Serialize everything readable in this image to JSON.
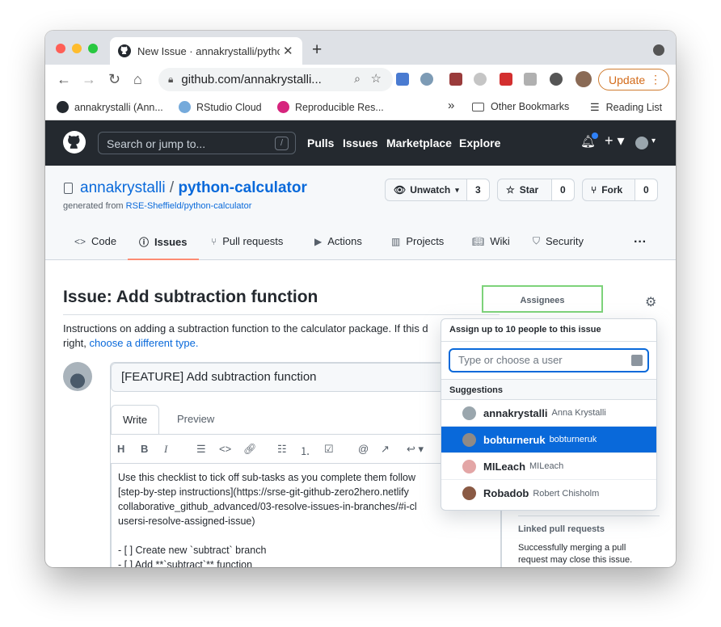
{
  "browser": {
    "tab_title": "New Issue · annakrystalli/pytho",
    "tab_close": "✕",
    "new_tab": "+",
    "url": "github.com/annakrystalli...",
    "update_label": "Update",
    "bookmarks": [
      {
        "label": "annakrystalli (Ann...",
        "color": "#24292f"
      },
      {
        "label": "RStudio Cloud",
        "color": "#75aadb"
      },
      {
        "label": "Reproducible Res...",
        "color": "#d6247d"
      }
    ],
    "bookmarks_more": "»",
    "other_bookmarks": "Other Bookmarks",
    "reading_list": "Reading List"
  },
  "github": {
    "search_placeholder": "Search or jump to...",
    "search_key": "/",
    "nav": [
      "Pulls",
      "Issues",
      "Marketplace",
      "Explore"
    ]
  },
  "repo": {
    "owner": "annakrystalli",
    "separator": "/",
    "name": "python-calculator",
    "generated_prefix": "generated from",
    "generated_link": "RSE-Sheffield/python-calculator",
    "unwatch_label": "Unwatch",
    "unwatch_count": "3",
    "star_label": "Star",
    "star_count": "0",
    "fork_label": "Fork",
    "fork_count": "0",
    "tabs": [
      "Code",
      "Issues",
      "Pull requests",
      "Actions",
      "Projects",
      "Wiki",
      "Security"
    ],
    "more": "···"
  },
  "issue": {
    "heading": "Issue: Add subtraction function",
    "instructions_line1": "Instructions on adding a subtraction function to the calculator package. If this d",
    "instructions_line2": "right,",
    "instructions_link": "choose a different type.",
    "title_value": "[FEATURE] Add subtraction function",
    "write_tab": "Write",
    "preview_tab": "Preview",
    "body_lines": [
      "Use this checklist to tick off sub-tasks as you complete them follow",
      "[step-by-step instructions](https://srse-git-github-zero2hero.netlify",
      "collaborative_github_advanced/03-resolve-issues-in-branches/#i-cl",
      "usersi-resolve-assigned-issue)",
      "",
      "- [ ] Create new `subtract` branch",
      "- [ ] Add **`subtract`** function"
    ]
  },
  "sidebar": {
    "assignees_label": "Assignees",
    "popup_title": "Assign up to 10 people to this issue",
    "filter_placeholder": "Type or choose a user",
    "suggestions_label": "Suggestions",
    "users": [
      {
        "username": "annakrystalli",
        "fullname": "Anna Krystalli",
        "selected": false,
        "color": "#9aa6ad"
      },
      {
        "username": "bobturneruk",
        "fullname": "bobturneruk",
        "selected": true,
        "color": "#8f8a86"
      },
      {
        "username": "MILeach",
        "fullname": "MILeach",
        "selected": false,
        "color": "#e3a6a6"
      },
      {
        "username": "Robadob",
        "fullname": "Robert Chisholm",
        "selected": false,
        "color": "#8a5a44"
      }
    ],
    "linked_title": "Linked pull requests",
    "linked_text_1": "Successfully merging a pull",
    "linked_text_2": "request may close this issue."
  }
}
